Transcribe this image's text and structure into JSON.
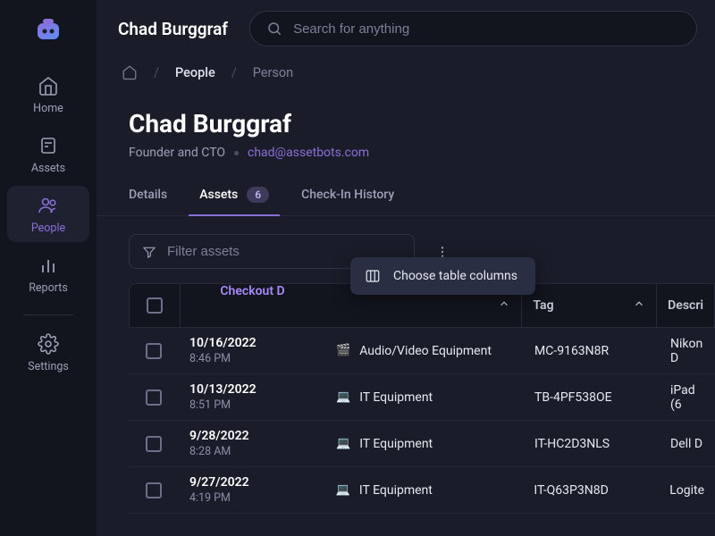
{
  "sidebar": {
    "items": [
      {
        "label": "Home"
      },
      {
        "label": "Assets"
      },
      {
        "label": "People"
      },
      {
        "label": "Reports"
      },
      {
        "label": "Settings"
      }
    ]
  },
  "topbar": {
    "title": "Chad Burggraf"
  },
  "search": {
    "placeholder": "Search for anything"
  },
  "breadcrumb": {
    "people": "People",
    "person": "Person"
  },
  "person": {
    "name": "Chad Burggraf",
    "role": "Founder and CTO",
    "email": "chad@assetbots.com"
  },
  "tabs": {
    "details": "Details",
    "assets": "Assets",
    "assets_count": "6",
    "history": "Check-In History"
  },
  "filter": {
    "placeholder": "Filter assets"
  },
  "popover": {
    "label": "Choose table columns"
  },
  "columns": {
    "date": "Checkout D",
    "tag": "Tag",
    "desc": "Descri"
  },
  "rows": [
    {
      "date": "10/16/2022",
      "time": "8:46 PM",
      "cat_icon": "🎬",
      "cat": "Audio/Video Equipment",
      "tag": "MC-9163N8R",
      "desc": "Nikon D"
    },
    {
      "date": "10/13/2022",
      "time": "8:51 PM",
      "cat_icon": "💻",
      "cat": "IT Equipment",
      "tag": "TB-4PF538OE",
      "desc": "iPad (6"
    },
    {
      "date": "9/28/2022",
      "time": "8:28 AM",
      "cat_icon": "💻",
      "cat": "IT Equipment",
      "tag": "IT-HC2D3NLS",
      "desc": "Dell D"
    },
    {
      "date": "9/27/2022",
      "time": "4:19 PM",
      "cat_icon": "💻",
      "cat": "IT Equipment",
      "tag": "IT-Q63P3N8D",
      "desc": "Logite"
    }
  ]
}
